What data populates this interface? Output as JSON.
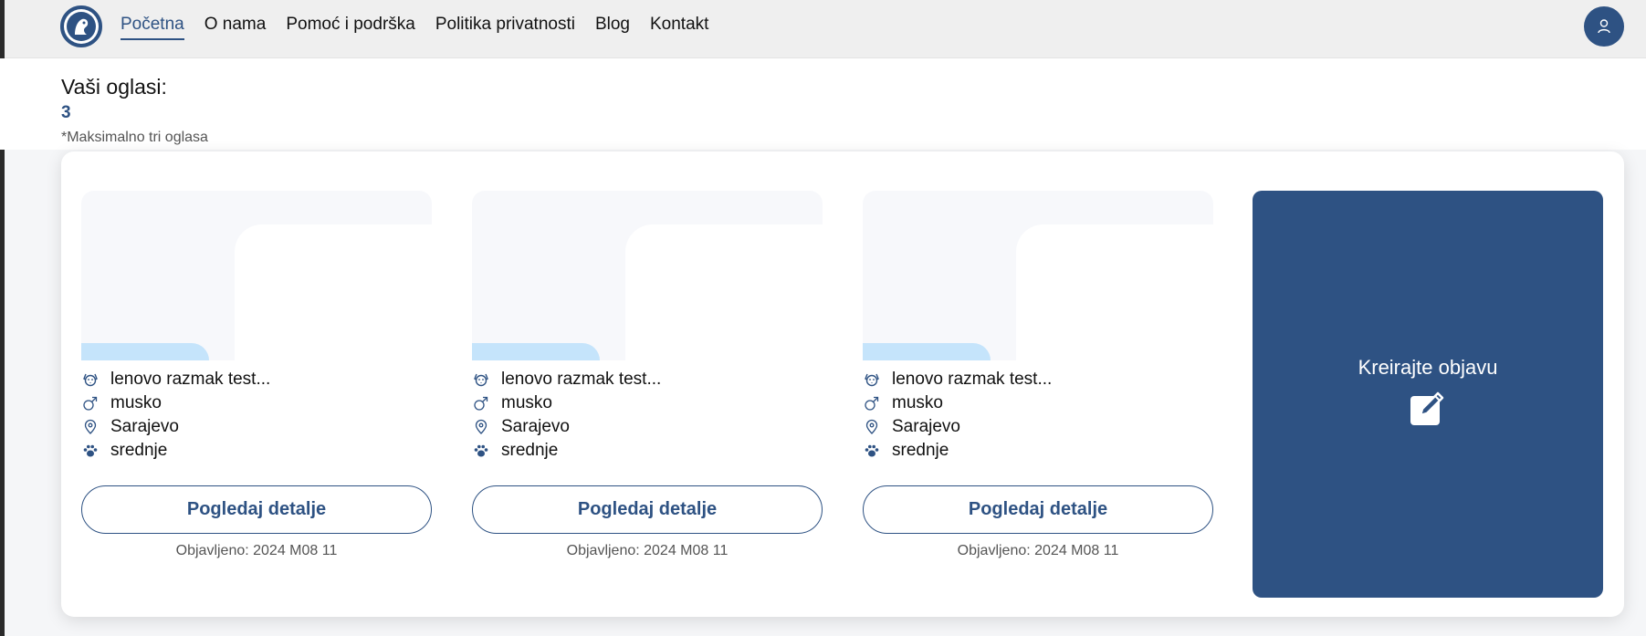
{
  "nav": {
    "links": [
      "Početna",
      "O nama",
      "Pomoć i podrška",
      "Politika privatnosti",
      "Blog",
      "Kontakt"
    ],
    "active_index": 0
  },
  "main": {
    "title": "Vaši oglasi:",
    "count": "3",
    "note": "*Maksimalno tri oglasa"
  },
  "cards": [
    {
      "name": "lenovo razmak test...",
      "gender": "musko",
      "location": "Sarajevo",
      "size": "srednje",
      "button": "Pogledaj detalje",
      "published": "Objavljeno: 2024 M08 11"
    },
    {
      "name": "lenovo razmak test...",
      "gender": "musko",
      "location": "Sarajevo",
      "size": "srednje",
      "button": "Pogledaj detalje",
      "published": "Objavljeno: 2024 M08 11"
    },
    {
      "name": "lenovo razmak test...",
      "gender": "musko",
      "location": "Sarajevo",
      "size": "srednje",
      "button": "Pogledaj detalje",
      "published": "Objavljeno: 2024 M08 11"
    }
  ],
  "create": {
    "label": "Kreirajte objavu"
  },
  "colors": {
    "primary": "#2e5283",
    "image_bg": "#f7f8fb",
    "image_accent": "#c5e4fb"
  },
  "icons": [
    "dog-face-icon",
    "male-icon",
    "location-pin-icon",
    "paw-icon",
    "edit-icon",
    "user-icon",
    "logo-icon"
  ]
}
